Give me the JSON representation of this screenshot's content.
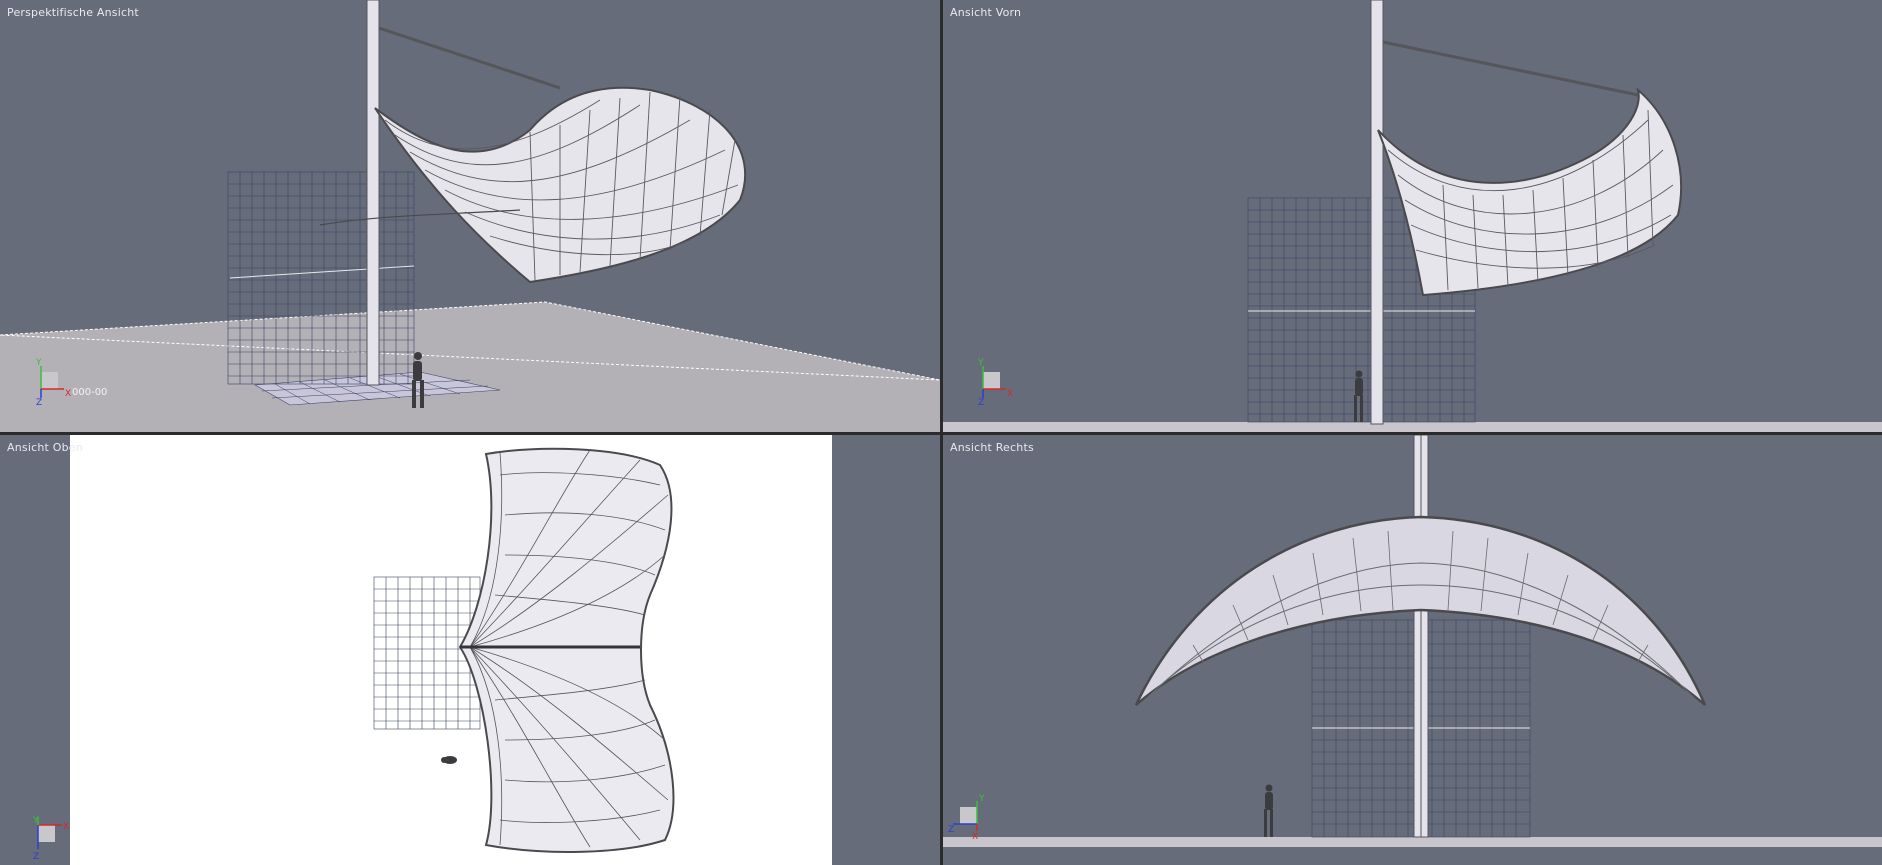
{
  "viewports": {
    "perspective": {
      "label": "Perspektifische Ansicht",
      "coord_readout": "000-00"
    },
    "front": {
      "label": "Ansicht Vorn"
    },
    "top": {
      "label": "Ansicht Oben"
    },
    "right": {
      "label": "Ansicht Rechts"
    }
  },
  "colors": {
    "viewport_bg": "#676c7a",
    "top_view_paper": "#ffffff",
    "grid_line": "#3a4466",
    "mesh_line": "#4a4a4e",
    "floor": "#b7b3ba",
    "axis_x": "#d22b2b",
    "axis_y": "#3bbf3b",
    "axis_z": "#2b3fd2"
  },
  "icons": {
    "axis_gizmo": "xyz-axis-gizmo-icon",
    "human_figure": "human-scale-figure-icon"
  }
}
